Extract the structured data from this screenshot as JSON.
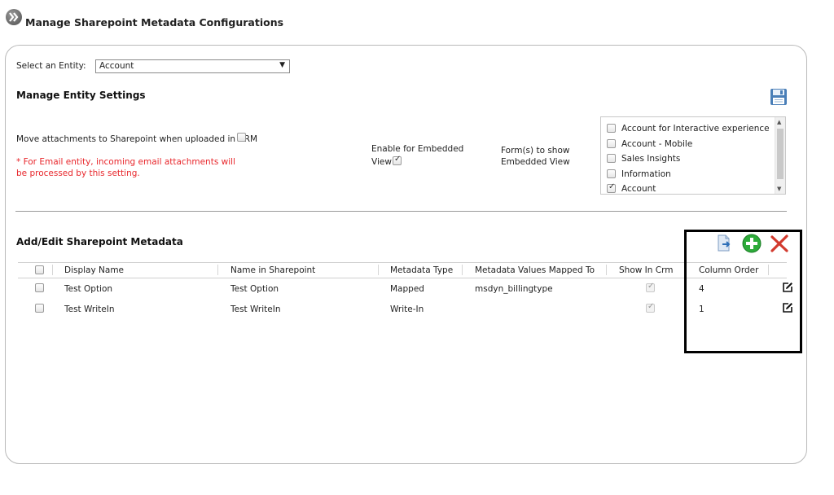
{
  "header": {
    "title": "Manage Sharepoint Metadata Configurations"
  },
  "entity": {
    "label": "Select an Entity:",
    "selected": "Account"
  },
  "entity_settings": {
    "title": "Manage Entity Settings",
    "move_attachments_label": "Move attachments to Sharepoint when uploaded in CRM",
    "note_line1": "* For Email entity, incoming email attachments will",
    "note_line2": "be processed by this setting.",
    "embedded_label_line1": "Enable for Embedded",
    "embedded_label_line2": "View",
    "forms_label_line1": "Form(s) to show",
    "forms_label_line2": "Embedded View",
    "forms": [
      {
        "label": "Account for Interactive experience",
        "checked": false
      },
      {
        "label": "Account - Mobile",
        "checked": false
      },
      {
        "label": "Sales Insights",
        "checked": false
      },
      {
        "label": "Information",
        "checked": false
      },
      {
        "label": "Account",
        "checked": true
      }
    ]
  },
  "metadata": {
    "title": "Add/Edit Sharepoint Metadata",
    "columns": {
      "display_name": "Display Name",
      "name_in_sharepoint": "Name in Sharepoint",
      "metadata_type": "Metadata Type",
      "values_mapped_to": "Metadata Values Mapped To",
      "show_in_crm": "Show In Crm",
      "column_order": "Column Order"
    },
    "rows": [
      {
        "display_name": "Test Option",
        "name_in_sharepoint": "Test Option",
        "metadata_type": "Mapped",
        "values_mapped_to": "msdyn_billingtype",
        "show_in_crm": true,
        "column_order": "4"
      },
      {
        "display_name": "Test WriteIn",
        "name_in_sharepoint": "Test WriteIn",
        "metadata_type": "Write-In",
        "values_mapped_to": "",
        "show_in_crm": true,
        "column_order": "1"
      }
    ]
  },
  "colors": {
    "note_red": "#e8262b",
    "add_green": "#2dab3a",
    "delete_red": "#d23a2e",
    "save_blue": "#4a7fb8"
  },
  "icons": [
    "chevron-double-right-icon",
    "save-icon",
    "import-icon",
    "add-icon",
    "delete-icon",
    "edit-icon"
  ]
}
